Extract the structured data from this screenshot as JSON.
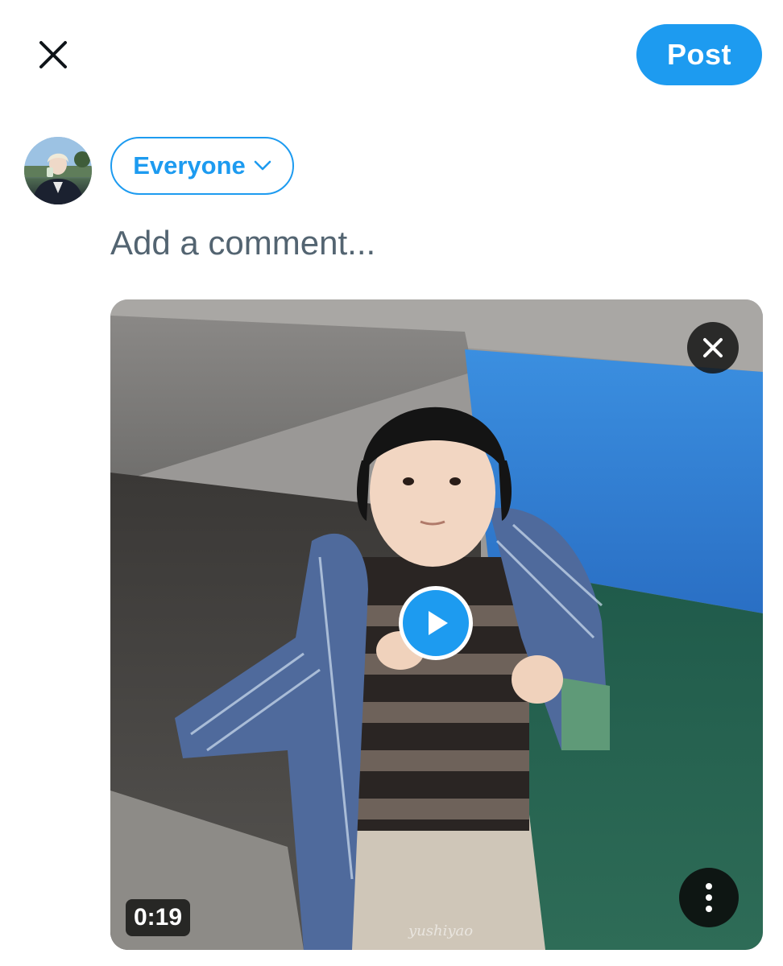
{
  "header": {
    "close_icon": "close-icon",
    "post_label": "Post"
  },
  "composer": {
    "avatar_icon": "user-avatar",
    "audience_label": "Everyone",
    "audience_icon": "chevron-down-icon",
    "comment_placeholder": "Add a comment...",
    "comment_value": ""
  },
  "media": {
    "type": "video",
    "duration": "0:19",
    "watermark": "yushiyao",
    "play_icon": "play-icon",
    "remove_icon": "close-icon",
    "more_icon": "more-vertical-icon"
  },
  "colors": {
    "accent": "#1d9bf0",
    "placeholder": "#536471"
  }
}
